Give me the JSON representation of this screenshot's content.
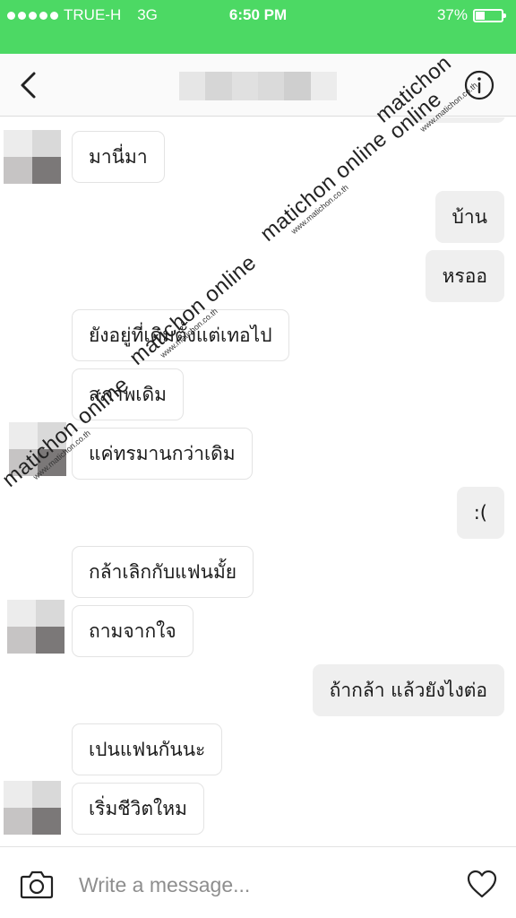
{
  "status": {
    "carrier": "TRUE-H",
    "network": "3G",
    "time": "6:50 PM",
    "battery": "37%",
    "battery_level": 0.37
  },
  "header": {
    "back_icon": "chevron-left-icon",
    "info_icon": "info-icon"
  },
  "watermark": {
    "brand": "matichon online",
    "url": "www.matichon.co.th"
  },
  "messages": [
    {
      "side": "in",
      "text": "มานี่มา"
    },
    {
      "side": "out",
      "text": "บ้าน"
    },
    {
      "side": "out",
      "text": "หรออ"
    },
    {
      "side": "in",
      "text": "ยังอยู่ที่เดิมตั้งแต่เทอไป"
    },
    {
      "side": "in",
      "text": "สภาพเดิม"
    },
    {
      "side": "in",
      "text": "แค่ทรมานกว่าเดิม"
    },
    {
      "side": "out",
      "text": ":("
    },
    {
      "side": "in",
      "text": "กล้าเลิกกับแฟนมั้ย"
    },
    {
      "side": "in",
      "text": "ถามจากใจ"
    },
    {
      "side": "out",
      "text": "ถ้ากล้า แล้วยังไงต่อ"
    },
    {
      "side": "in",
      "text": "เปนแฟนกันนะ"
    },
    {
      "side": "in",
      "text": "เริ่มชีวิตใหม"
    }
  ],
  "composer": {
    "placeholder": "Write a message...",
    "camera_icon": "camera-icon",
    "heart_icon": "heart-icon"
  },
  "colors": {
    "status_bar": "#4cd964",
    "outgoing_bubble": "#efefef",
    "incoming_border": "#e3e3e3"
  }
}
